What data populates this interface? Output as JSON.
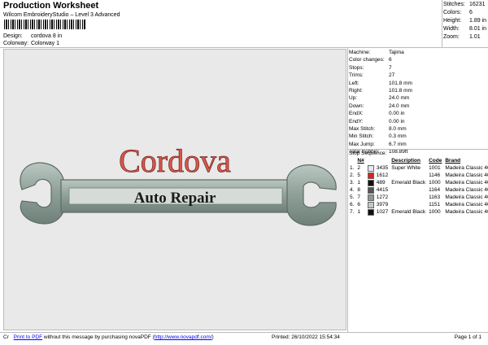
{
  "header": {
    "title": "Production Worksheet",
    "subtitle": "Wilcom EmbroideryStudio – Level 3 Advanced",
    "design_label": "Design:",
    "design_value": "cordova 8 in",
    "colorway_label": "Colorway:",
    "colorway_value": "Colorway 1"
  },
  "stats": [
    {
      "k": "Stitches:",
      "v": "16231"
    },
    {
      "k": "Colors:",
      "v": "6"
    },
    {
      "k": "Height:",
      "v": "1.89 in"
    },
    {
      "k": "Width:",
      "v": "8.01 in"
    },
    {
      "k": "Zoom:",
      "v": "1.01"
    }
  ],
  "machine_info": [
    {
      "k": "Machine:",
      "v": "Tajima"
    },
    {
      "k": "Color changes:",
      "v": "6"
    },
    {
      "k": "Stops:",
      "v": "7"
    },
    {
      "k": "Trims:",
      "v": "27"
    },
    {
      "k": "Left:",
      "v": "101.8 mm"
    },
    {
      "k": "Right:",
      "v": "101.8 mm"
    },
    {
      "k": "Up:",
      "v": "24.0 mm"
    },
    {
      "k": "Down:",
      "v": "24.0 mm"
    },
    {
      "k": "EndX:",
      "v": "0.00 in"
    },
    {
      "k": "EndY:",
      "v": "0.00 in"
    },
    {
      "k": "Max Stitch:",
      "v": "8.0 mm"
    },
    {
      "k": "Min Stitch:",
      "v": "0.3 mm"
    },
    {
      "k": "Max Jump:",
      "v": "6.7 mm"
    },
    {
      "k": "Total Bobbin:",
      "v": "108.89ft"
    }
  ],
  "stop_sequence": {
    "title": "Stop Sequence:",
    "headers": [
      "",
      "N#",
      "",
      "Description",
      "Code",
      "Brand"
    ],
    "rows": [
      {
        "stop": "1.",
        "n": "2",
        "color": "#e8e8f0",
        "num": "3435",
        "desc": "Super White",
        "code": "1001",
        "brand": "Madeira Classic 40"
      },
      {
        "stop": "2.",
        "n": "5",
        "color": "#e02020",
        "num": "1612",
        "desc": "",
        "code": "1146",
        "brand": "Madeira Classic 40"
      },
      {
        "stop": "3.",
        "n": "1",
        "color": "#111111",
        "num": "489",
        "desc": "Emerald Black",
        "code": "1000",
        "brand": "Madeira Classic 40"
      },
      {
        "stop": "4.",
        "n": "8",
        "color": "#555555",
        "num": "4415",
        "desc": "",
        "code": "1164",
        "brand": "Madeira Classic 40"
      },
      {
        "stop": "5.",
        "n": "7",
        "color": "#8a9a94",
        "num": "1272",
        "desc": "",
        "code": "1163",
        "brand": "Madeira Classic 40"
      },
      {
        "stop": "6.",
        "n": "6",
        "color": "#c4c8c6",
        "num": "3979",
        "desc": "",
        "code": "1151",
        "brand": "Madeira Classic 40"
      },
      {
        "stop": "7.",
        "n": "1",
        "color": "#111111",
        "num": "1027",
        "desc": "Emerald Black",
        "code": "1000",
        "brand": "Madeira Classic 40"
      }
    ]
  },
  "design": {
    "line1": "Cordova",
    "line2": "Auto Repair",
    "red": "#d9584e",
    "wrench": "#9aaba2"
  },
  "footer": {
    "prefix": "Cr",
    "link_text": "Print to PDF",
    "message": " without this message by purchasing novaPDF (",
    "url": "http://www.novapdf.com/",
    "close": ")",
    "printed": "Printed: 26/10/2022 15:54:34",
    "page": "Page 1 of 1"
  }
}
